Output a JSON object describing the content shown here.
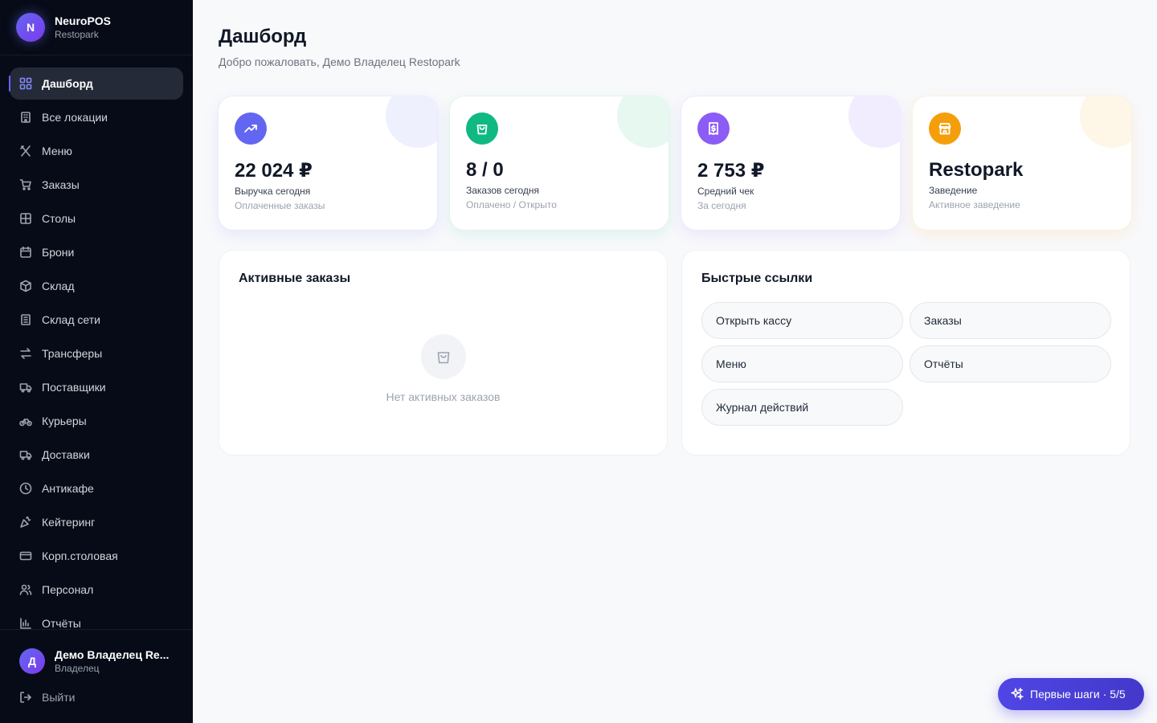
{
  "brand": {
    "initial": "N",
    "name": "NeuroPOS",
    "subtitle": "Restopark"
  },
  "sidebar": {
    "items": [
      {
        "label": "Дашборд",
        "icon": "dashboard-icon",
        "active": true
      },
      {
        "label": "Все локации",
        "icon": "building-icon"
      },
      {
        "label": "Меню",
        "icon": "utensils-icon"
      },
      {
        "label": "Заказы",
        "icon": "cart-icon"
      },
      {
        "label": "Столы",
        "icon": "grid-icon"
      },
      {
        "label": "Брони",
        "icon": "calendar-icon"
      },
      {
        "label": "Склад",
        "icon": "package-icon"
      },
      {
        "label": "Склад сети",
        "icon": "warehouse-icon"
      },
      {
        "label": "Трансферы",
        "icon": "arrows-icon"
      },
      {
        "label": "Поставщики",
        "icon": "truck-icon"
      },
      {
        "label": "Курьеры",
        "icon": "bike-icon"
      },
      {
        "label": "Доставки",
        "icon": "delivery-icon"
      },
      {
        "label": "Антикафе",
        "icon": "clock-icon"
      },
      {
        "label": "Кейтеринг",
        "icon": "party-icon"
      },
      {
        "label": "Корп.столовая",
        "icon": "card-icon"
      },
      {
        "label": "Персонал",
        "icon": "users-icon"
      },
      {
        "label": "Отчёты",
        "icon": "chart-icon"
      }
    ]
  },
  "user": {
    "initial": "Д",
    "name": "Демо Владелец Re...",
    "role": "Владелец",
    "logout_label": "Выйти"
  },
  "header": {
    "title": "Дашборд",
    "subtitle": "Добро пожаловать, Демо Владелец Restopark"
  },
  "stats": [
    {
      "value": "22 024 ₽",
      "label": "Выручка сегодня",
      "hint": "Оплаченные заказы",
      "color": "#6366f1",
      "deco": "#eef0fe",
      "icon": "trending-up-icon"
    },
    {
      "value": "8 / 0",
      "label": "Заказов сегодня",
      "hint": "Оплачено / Открыто",
      "color": "#10b981",
      "deco": "#e6f8f0",
      "icon": "shopping-bag-icon"
    },
    {
      "value": "2 753 ₽",
      "label": "Средний чек",
      "hint": "За сегодня",
      "color": "#8b5cf6",
      "deco": "#f1edfe",
      "icon": "receipt-icon"
    },
    {
      "value": "Restopark",
      "label": "Заведение",
      "hint": "Активное заведение",
      "color": "#f59e0b",
      "deco": "#fef6e6",
      "icon": "store-icon"
    }
  ],
  "active_orders": {
    "title": "Активные заказы",
    "empty_text": "Нет активных заказов"
  },
  "quick_links": {
    "title": "Быстрые ссылки",
    "links": [
      "Открыть кассу",
      "Заказы",
      "Меню",
      "Отчёты",
      "Журнал действий"
    ]
  },
  "fab": {
    "label": "Первые шаги · 5/5"
  }
}
